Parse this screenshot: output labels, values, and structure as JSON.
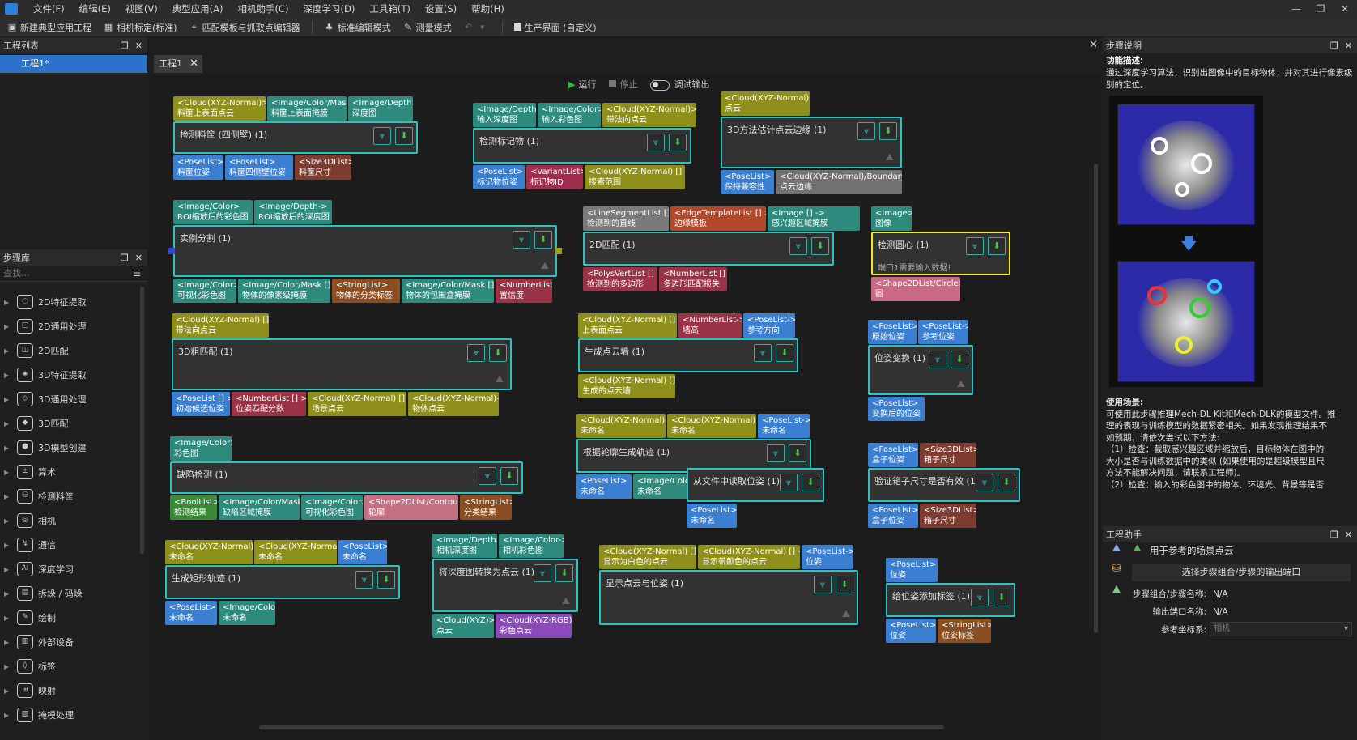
{
  "menu": [
    "文件(F)",
    "编辑(E)",
    "视图(V)",
    "典型应用(A)",
    "相机助手(C)",
    "深度学习(D)",
    "工具箱(T)",
    "设置(S)",
    "帮助(H)"
  ],
  "window_controls": [
    "—",
    "❐",
    "✕"
  ],
  "toolbar": {
    "new_project": "新建典型应用工程",
    "calibration": "相机标定(标准)",
    "match_editor": "匹配模板与抓取点编辑器",
    "standard_edit": "标准编辑模式",
    "measure": "测量模式",
    "production": "生产界面 (自定义)"
  },
  "project_panel": {
    "title": "工程列表",
    "item": "工程1*"
  },
  "step_library": {
    "title": "步骤库",
    "search_placeholder": "查找...",
    "items": [
      {
        "label": "2D特征提取",
        "icon": "circle-dashed-icon"
      },
      {
        "label": "2D通用处理",
        "icon": "square-icon"
      },
      {
        "label": "2D匹配",
        "icon": "match-2d-icon"
      },
      {
        "label": "3D特征提取",
        "icon": "cube-feature-icon"
      },
      {
        "label": "3D通用处理",
        "icon": "cube-icon"
      },
      {
        "label": "3D匹配",
        "icon": "match-3d-icon"
      },
      {
        "label": "3D模型创建",
        "icon": "model-icon"
      },
      {
        "label": "算术",
        "icon": "calc-icon"
      },
      {
        "label": "检测料筐",
        "icon": "bin-icon"
      },
      {
        "label": "相机",
        "icon": "camera-icon"
      },
      {
        "label": "通信",
        "icon": "signal-icon"
      },
      {
        "label": "深度学习",
        "icon": "ai-icon"
      },
      {
        "label": "拆垛 / 码垛",
        "icon": "stack-icon"
      },
      {
        "label": "绘制",
        "icon": "pen-icon"
      },
      {
        "label": "外部设备",
        "icon": "device-icon"
      },
      {
        "label": "标签",
        "icon": "tag-icon"
      },
      {
        "label": "映射",
        "icon": "map-icon"
      },
      {
        "label": "掩模处理",
        "icon": "mask-icon"
      }
    ]
  },
  "canvas": {
    "tab": "工程1",
    "run": "运行",
    "stop": "停止",
    "debug": "调试输出"
  },
  "steps": {
    "s1": {
      "title": "检测料筐 (四侧壁) (1)",
      "in": [
        [
          "<Cloud(XYZ-Normal)>",
          "料筐上表面点云"
        ],
        [
          "<Image/Color/Mask>",
          "料筐上表面掩膜"
        ],
        [
          "<Image/Depth>",
          "深度图"
        ]
      ],
      "out": [
        [
          "<PoseList>",
          "料筐位姿"
        ],
        [
          "<PoseList>",
          "料筐四侧壁位姿"
        ],
        [
          "<Size3DList>",
          "料筐尺寸"
        ]
      ]
    },
    "s2": {
      "title": "检测标记物 (1)",
      "in": [
        [
          "<Image/Depth>",
          "输入深度图"
        ],
        [
          "<Image/Color>",
          "输入彩色图"
        ],
        [
          "<Cloud(XYZ-Normal)>",
          "带法向点云"
        ]
      ],
      "out": [
        [
          "<PoseList>",
          "标记物位姿"
        ],
        [
          "<VariantList>",
          "标记物ID"
        ],
        [
          "<Cloud(XYZ-Normal) [] >",
          "搜索范围"
        ]
      ]
    },
    "s3": {
      "title": "3D方法估计点云边缘 (1)",
      "in": [
        [
          "<Cloud(XYZ-Normal)>",
          "点云"
        ]
      ],
      "out": [
        [
          "<PoseList>",
          "保持兼容性"
        ],
        [
          "<Cloud(XYZ-Normal)/Boundary>",
          "点云边缘"
        ]
      ]
    },
    "s4": {
      "title": "实例分割 (1)",
      "in": [
        [
          "<Image/Color>",
          "ROI缩放后的彩色图"
        ],
        [
          "<Image/Depth->",
          "ROI缩放后的深度图"
        ]
      ],
      "out": [
        [
          "<Image/Color>",
          "可视化彩色图"
        ],
        [
          "<Image/Color/Mask [] >",
          "物体的像素级掩膜"
        ],
        [
          "<StringList>",
          "物体的分类标签"
        ],
        [
          "<Image/Color/Mask [] >",
          "物体的包围盒掩膜"
        ],
        [
          "<NumberList>",
          "置信度"
        ]
      ]
    },
    "s5": {
      "title": "2D匹配 (1)",
      "in": [
        [
          "<LineSegmentList [] >",
          "检测到的直线"
        ],
        [
          "<EdgeTemplateList [] >",
          "边缘模板"
        ],
        [
          "<Image [] ->",
          "感兴趣区域掩膜"
        ]
      ],
      "out": [
        [
          "<PolysVertList [] >",
          "检测到的多边形"
        ],
        [
          "<NumberList [] >",
          "多边形匹配损失"
        ]
      ]
    },
    "s6": {
      "title": "检测圆心 (1)",
      "sub": "端口1需要输入数据!",
      "in": [
        [
          "<Image>",
          "图像"
        ]
      ],
      "out": [
        [
          "<Shape2DList/Circle>",
          "圆"
        ]
      ]
    },
    "s7": {
      "title": "3D粗匹配 (1)",
      "in": [
        [
          "<Cloud(XYZ-Normal) [] >",
          "带法向点云"
        ]
      ],
      "out": [
        [
          "<PoseList [] >",
          "初始候选位姿"
        ],
        [
          "<NumberList [] >",
          "位姿匹配分数"
        ],
        [
          "<Cloud(XYZ-Normal) [] ->",
          "场景点云"
        ],
        [
          "<Cloud(XYZ-Normal)->",
          "物体点云"
        ]
      ]
    },
    "s8": {
      "title": "生成点云墙 (1)",
      "in": [
        [
          "<Cloud(XYZ-Normal) [] >",
          "上表面点云"
        ],
        [
          "<NumberList->",
          "墙高"
        ],
        [
          "<PoseList->",
          "参考方向"
        ]
      ],
      "out": [
        [
          "<Cloud(XYZ-Normal) [] >",
          "生成的点云墙"
        ]
      ]
    },
    "s9": {
      "title": "位姿变换 (1)",
      "in": [
        [
          "<PoseList>",
          "原始位姿"
        ],
        [
          "<PoseList->",
          "参考位姿"
        ]
      ],
      "out": [
        [
          "<PoseList>",
          "变换后的位姿"
        ]
      ]
    },
    "s10": {
      "title": "缺陷检测 (1)",
      "in": [
        [
          "<Image/Color>",
          "彩色图"
        ]
      ],
      "out": [
        [
          "<BoolList>",
          "检测结果"
        ],
        [
          "<Image/Color/Mask>",
          "缺陷区域掩膜"
        ],
        [
          "<Image/Color>",
          "可视化彩色图"
        ],
        [
          "<Shape2DList/Contour>",
          "轮廓"
        ],
        [
          "<StringList>",
          "分类结果"
        ]
      ]
    },
    "s11": {
      "title": "根据轮廓生成轨迹 (1)",
      "in": [
        [
          "<Cloud(XYZ-Normal)>",
          "未命名"
        ],
        [
          "<Cloud(XYZ-Normal)>",
          "未命名"
        ],
        [
          "<PoseList->",
          "未命名"
        ]
      ],
      "out": [
        [
          "<PoseList>",
          "未命名"
        ],
        [
          "<Image/Color>",
          "未命名"
        ]
      ]
    },
    "s12": {
      "title": "从文件中读取位姿 (1)",
      "out": [
        [
          "<PoseList>",
          "未命名"
        ]
      ]
    },
    "s13": {
      "title": "验证箱子尺寸是否有效 (1)",
      "in": [
        [
          "<PoseList>",
          "盒子位姿"
        ],
        [
          "<Size3DList>",
          "箱子尺寸"
        ]
      ],
      "out": [
        [
          "<PoseList>",
          "盒子位姿"
        ],
        [
          "<Size3DList>",
          "箱子尺寸"
        ]
      ]
    },
    "s14": {
      "title": "生成矩形轨迹 (1)",
      "in": [
        [
          "<Cloud(XYZ-Normal)>",
          "未命名"
        ],
        [
          "<Cloud(XYZ-Normal)>",
          "未命名"
        ],
        [
          "<PoseList>",
          "未命名"
        ]
      ],
      "out": [
        [
          "<PoseList>",
          "未命名"
        ],
        [
          "<Image/Color>",
          "未命名"
        ]
      ]
    },
    "s15": {
      "title": "将深度图转换为点云 (1)",
      "in": [
        [
          "<Image/Depth>",
          "相机深度图"
        ],
        [
          "<Image/Color->",
          "相机彩色图"
        ]
      ],
      "out": [
        [
          "<Cloud(XYZ)>",
          "点云"
        ],
        [
          "<Cloud(XYZ-RGB)>",
          "彩色点云"
        ]
      ]
    },
    "s16": {
      "title": "显示点云与位姿 (1)",
      "in": [
        [
          "<Cloud(XYZ-Normal) [] >",
          "显示为白色的点云"
        ],
        [
          "<Cloud(XYZ-Normal) [] ->",
          "显示带颜色的点云"
        ],
        [
          "<PoseList->",
          "位姿"
        ]
      ],
      "out": []
    },
    "s17": {
      "title": "给位姿添加标签 (1)",
      "in": [
        [
          "<PoseList>",
          "位姿"
        ]
      ],
      "out": [
        [
          "<PoseList>",
          "位姿"
        ],
        [
          "<StringList>",
          "位姿标签"
        ]
      ]
    }
  },
  "right_panel": {
    "title": "步骤说明",
    "func_label": "功能描述:",
    "func_text": "通过深度学习算法，识别出图像中的目标物体，并对其进行像素级别的定位。",
    "usage_label": "使用场景:",
    "usage_lines": [
      "可使用此步骤推理Mech-DL Kit和Mech-DLK的模型文件。推",
      "理的表现与训练模型的数据紧密相关。如果发现推理结果不",
      "如预期，请依次尝试以下方法:",
      "（1）检查：截取感兴趣区域并缩放后，目标物体在图中的",
      "大小是否与训练数据中的类似 (如果使用的是超级模型且尺",
      "方法不能解决问题，请联系工程师)。",
      "（2）检查：输入的彩色图中的物体、环境光、背景等是否"
    ]
  },
  "helper": {
    "title": "工程助手",
    "item": "用于参考的场景点云",
    "select_btn": "选择步骤组合/步骤的输出端口",
    "rows": [
      {
        "k": "步骤组合/步骤名称:",
        "v": "N/A"
      },
      {
        "k": "输出端口名称:",
        "v": "N/A"
      }
    ],
    "coord_label": "参考坐标系:",
    "coord_placeholder": "相机"
  }
}
